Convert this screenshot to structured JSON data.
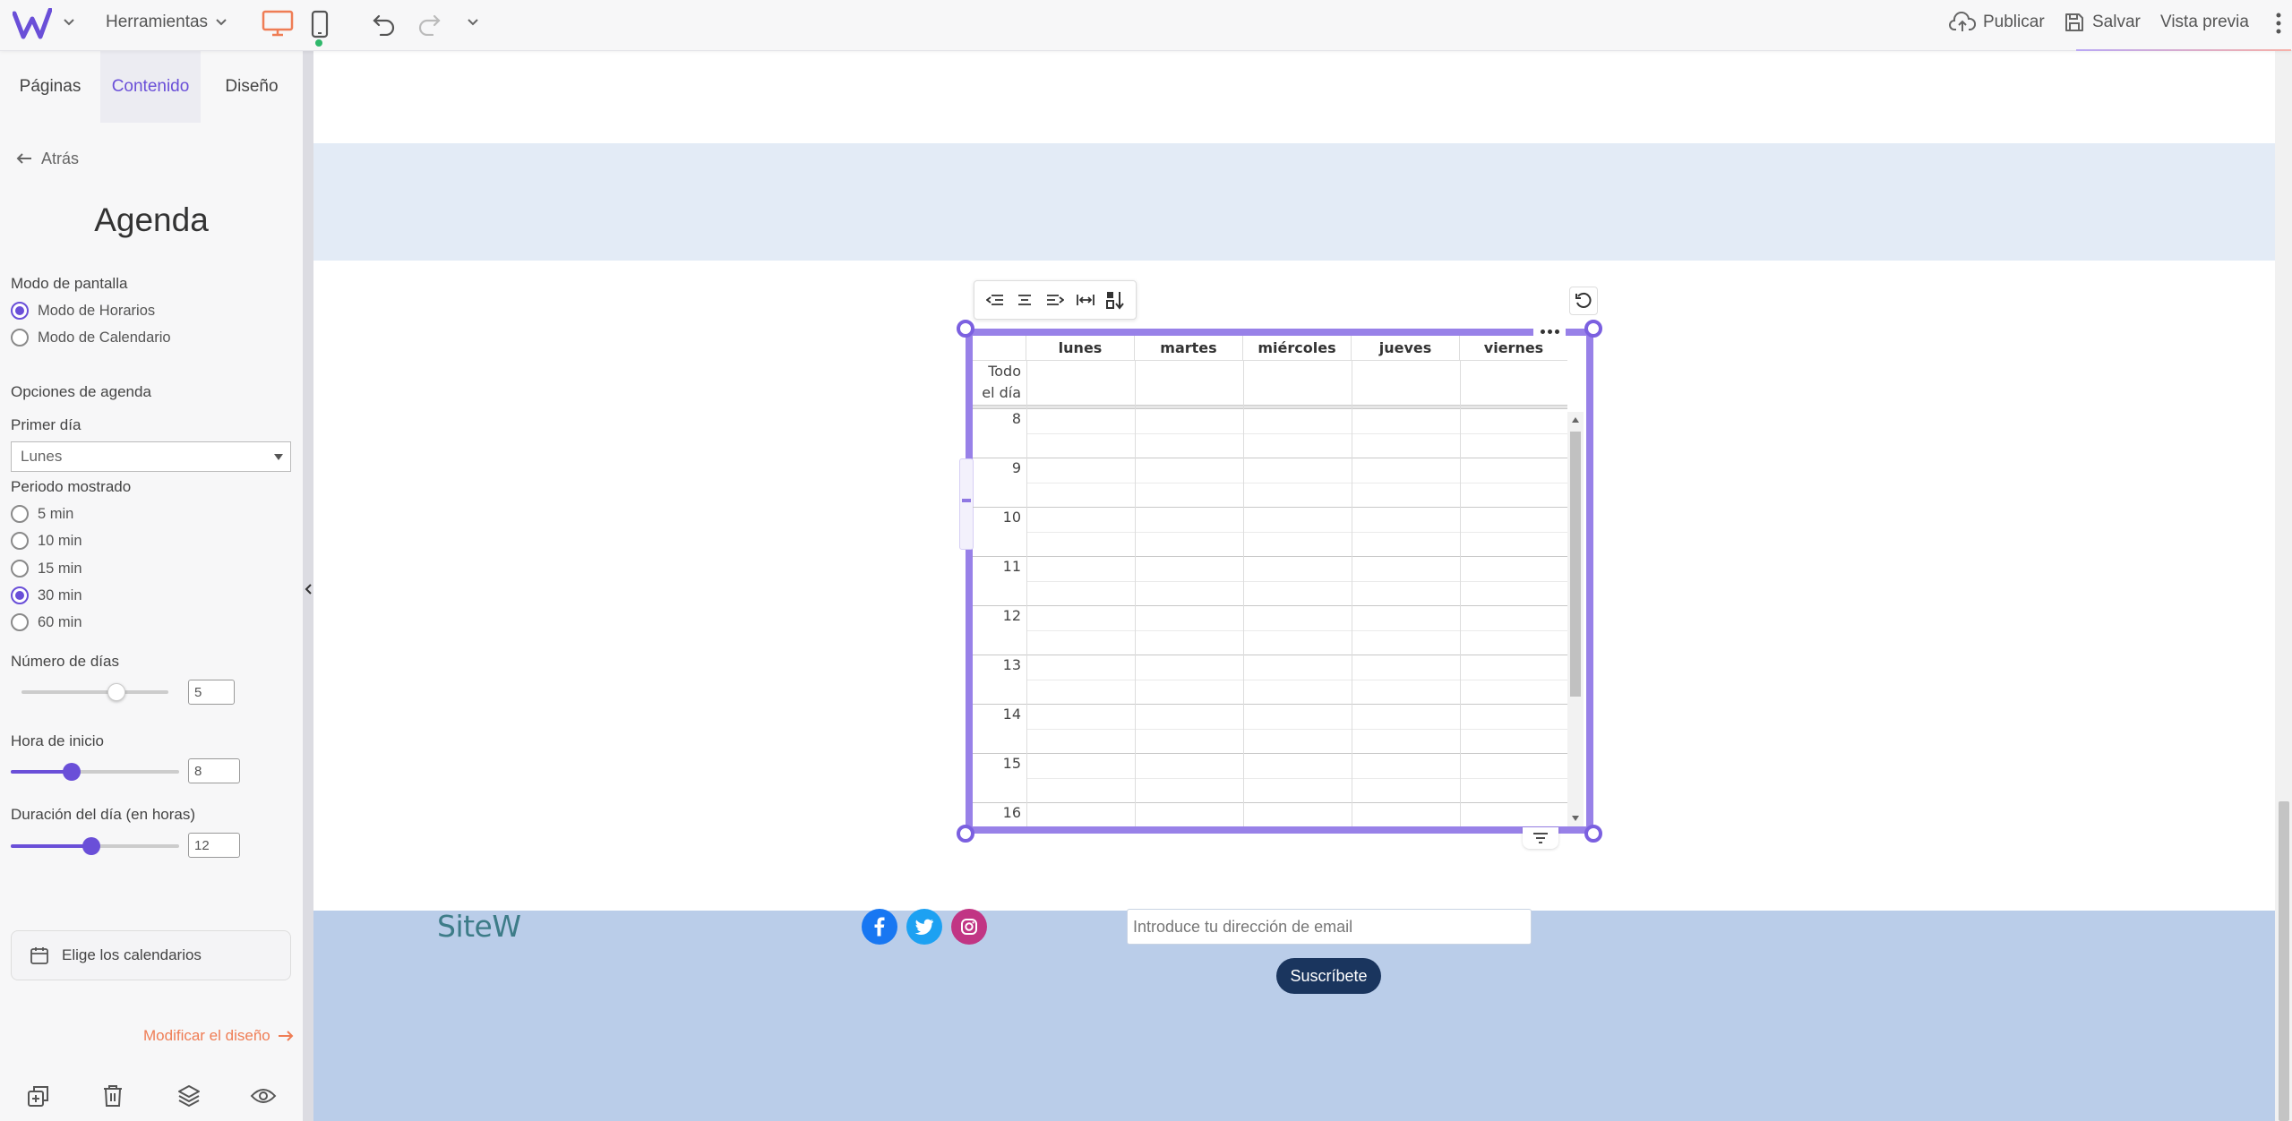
{
  "topbar": {
    "tools_label": "Herramientas",
    "publish_label": "Publicar",
    "save_label": "Salvar",
    "preview_label": "Vista previa"
  },
  "sidebar": {
    "tabs": [
      {
        "label": "Páginas"
      },
      {
        "label": "Contenido",
        "active": true
      },
      {
        "label": "Diseño"
      }
    ],
    "back_label": "Atrás",
    "panel_title": "Agenda",
    "display_mode": {
      "label": "Modo de pantalla",
      "options": [
        {
          "label": "Modo de Horarios",
          "checked": true
        },
        {
          "label": "Modo de Calendario",
          "checked": false
        }
      ]
    },
    "agenda_options_label": "Opciones de agenda",
    "first_day": {
      "label": "Primer día",
      "value": "Lunes"
    },
    "period": {
      "label": "Periodo mostrado",
      "options": [
        {
          "label": "5 min",
          "checked": false
        },
        {
          "label": "10 min",
          "checked": false
        },
        {
          "label": "15 min",
          "checked": false
        },
        {
          "label": "30 min",
          "checked": true
        },
        {
          "label": "60 min",
          "checked": false
        }
      ]
    },
    "num_days": {
      "label": "Número de días",
      "value": "5",
      "min": 1,
      "max": 7
    },
    "start_hour": {
      "label": "Hora de inicio",
      "value": "8",
      "min": 0,
      "max": 23
    },
    "day_duration": {
      "label": "Duración del día (en horas)",
      "value": "12",
      "min": 1,
      "max": 24
    },
    "choose_calendars_label": "Elige los calendarios",
    "modify_design_label": "Modificar el diseño"
  },
  "agenda": {
    "days": [
      "lunes",
      "martes",
      "miércoles",
      "jueves",
      "viernes"
    ],
    "allday_label": "Todo el día",
    "hours": [
      "8",
      "9",
      "10",
      "11",
      "12",
      "13",
      "14",
      "15",
      "16"
    ]
  },
  "footer": {
    "brand": "SiteW",
    "email_placeholder": "Introduce tu dirección de email",
    "subscribe_label": "Suscríbete"
  },
  "colors": {
    "accent": "#6a4fd8",
    "frame": "#9881e8",
    "orange": "#ef7d55",
    "footer_bg": "#bacde9",
    "band_bg": "#e3ebf6",
    "navy": "#1a355e",
    "facebook": "#1877f2",
    "twitter": "#1da1f2",
    "instagram": "#c13584"
  }
}
